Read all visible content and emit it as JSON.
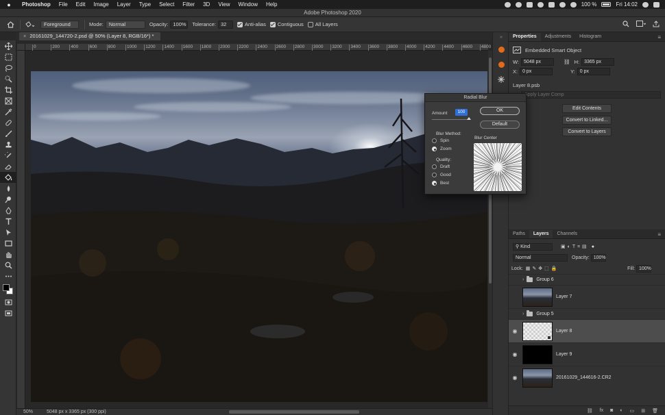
{
  "menubar": {
    "apple": "",
    "items": [
      "Photoshop",
      "File",
      "Edit",
      "Image",
      "Layer",
      "Type",
      "Select",
      "Filter",
      "3D",
      "View",
      "Window",
      "Help"
    ],
    "battery": "100 %",
    "clock": "Fri 14:02"
  },
  "window": {
    "title": "Adobe Photoshop 2020"
  },
  "options": {
    "fill_source": "Foreground",
    "mode_label": "Mode:",
    "mode_value": "Normal",
    "opacity_label": "Opacity:",
    "opacity_value": "100%",
    "tolerance_label": "Tolerance:",
    "tolerance_value": "32",
    "antialias_label": "Anti-alias",
    "antialias_checked": true,
    "contiguous_label": "Contiguous",
    "contiguous_checked": true,
    "all_layers_label": "All Layers",
    "all_layers_checked": false
  },
  "document": {
    "tab_title": "20161029_144720-2.psd @ 50% (Layer 8, RGB/16*) *",
    "ruler_ticks": [
      "0",
      "200",
      "400",
      "600",
      "800",
      "1000",
      "1200",
      "1400",
      "1600",
      "1800",
      "2000",
      "2200",
      "2400",
      "2600",
      "2800",
      "3000",
      "3200",
      "3400",
      "3600",
      "3800",
      "4000",
      "4200",
      "4400",
      "4600",
      "4800"
    ]
  },
  "status": {
    "zoom": "50%",
    "doc_info": "5048 px x 3365 px (300 ppi)"
  },
  "properties": {
    "tabs": [
      "Properties",
      "Adjustments",
      "Histogram"
    ],
    "active_tab": "Properties",
    "kind": "Embedded Smart Object",
    "w_label": "W:",
    "w_value": "5048 px",
    "h_label": "H:",
    "h_value": "3365 px",
    "x_label": "X:",
    "x_value": "0 px",
    "y_label": "Y:",
    "y_value": "0 px",
    "file": "Layer 8.psb",
    "layer_comp_placeholder": "Apply Layer Comp",
    "buttons": [
      "Edit Contents",
      "Convert to Linked...",
      "Convert to Layers"
    ]
  },
  "layers_panel": {
    "tabs": [
      "Paths",
      "Layers",
      "Channels"
    ],
    "active_tab": "Layers",
    "filter_kind": "Kind",
    "blend_mode": "Normal",
    "opacity_label": "Opacity:",
    "opacity_value": "100%",
    "lock_label": "Lock:",
    "fill_label": "Fill:",
    "fill_value": "100%",
    "layers": [
      {
        "name": "Group 6",
        "type": "group",
        "visible": false
      },
      {
        "name": "Layer 7",
        "type": "image",
        "visible": false
      },
      {
        "name": "Group 5",
        "type": "group",
        "visible": false
      },
      {
        "name": "Layer 8",
        "type": "smart",
        "visible": true,
        "selected": true
      },
      {
        "name": "Layer 9",
        "type": "black",
        "visible": true
      },
      {
        "name": "20161029_144616-2.CR2",
        "type": "image",
        "visible": true
      }
    ],
    "footer_fx": "fx"
  },
  "dialog": {
    "title": "Radial Blur",
    "amount_label": "Amount",
    "amount_value": "100",
    "ok": "OK",
    "default": "Default",
    "method_label": "Blur Method:",
    "methods": [
      "Spin",
      "Zoom"
    ],
    "method_selected": "Zoom",
    "quality_label": "Quality:",
    "qualities": [
      "Draft",
      "Good",
      "Best"
    ],
    "quality_selected": "Best",
    "center_label": "Blur Center"
  },
  "colors": {
    "accent": "#2f6fd6",
    "panel_bg": "#323232",
    "canvas_bg": "#282828",
    "selected_layer": "#4d4d4d",
    "foreground": "#000000",
    "background": "#ffffff"
  }
}
